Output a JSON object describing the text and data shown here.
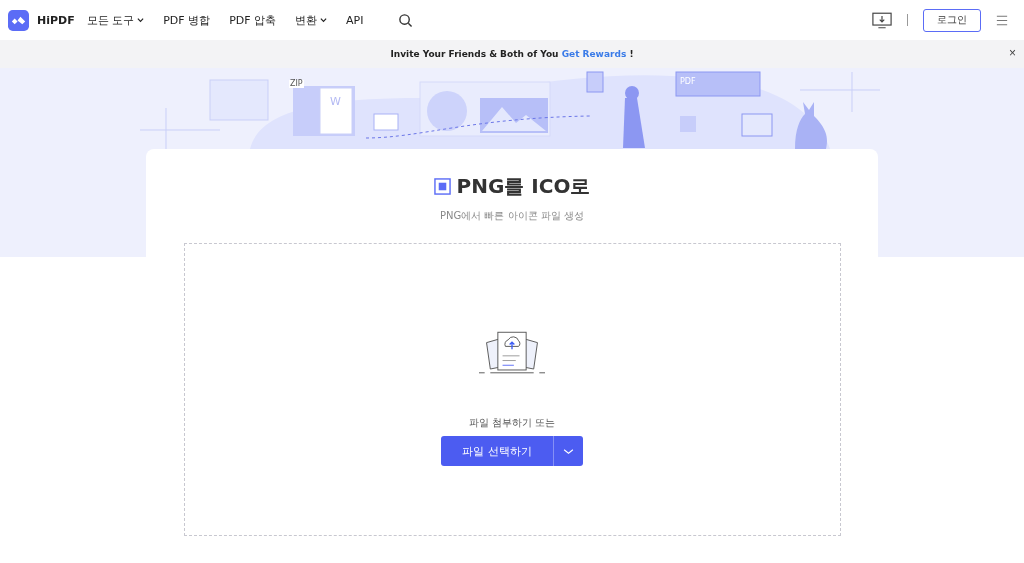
{
  "header": {
    "brand": "HiPDF",
    "nav": [
      {
        "label": "모든 도구",
        "dropdown": true
      },
      {
        "label": "PDF 병합",
        "dropdown": false
      },
      {
        "label": "PDF 압축",
        "dropdown": false
      },
      {
        "label": "변환",
        "dropdown": true
      },
      {
        "label": "API",
        "dropdown": false
      }
    ],
    "login": "로그인"
  },
  "promo": {
    "text": "Invite Your Friends & Both of You ",
    "link": "Get Rewards",
    "suffix": " !",
    "close": "×"
  },
  "illustration": {
    "labels": [
      "ZIP",
      "W",
      "PDF"
    ]
  },
  "tool": {
    "title": "PNG를 ICO로",
    "subtitle": "PNG에서 빠른 아이콘 파일 생성",
    "drop_hint": "파일 첨부하기 또는",
    "button": "파일 선택하기"
  }
}
